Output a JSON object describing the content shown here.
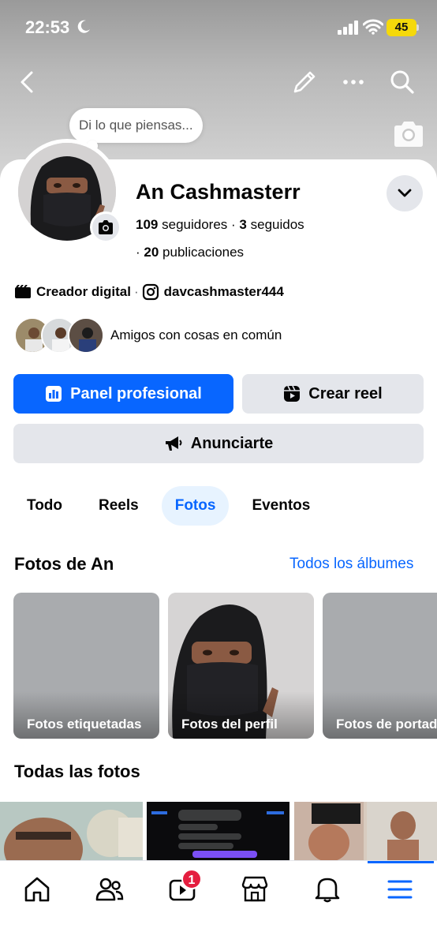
{
  "status_bar": {
    "time": "22:53",
    "battery": "45"
  },
  "profile": {
    "status_prompt": "Di lo que piensas...",
    "name": "An Cashmasterr",
    "followers_count": "109",
    "followers_label": "seguidores",
    "following_count": "3",
    "following_label": "seguidos",
    "posts_count": "20",
    "posts_label": "publicaciones",
    "category": "Creador digital",
    "instagram_handle": "davcashmaster444",
    "mutual_friends_text": "Amigos con cosas en común"
  },
  "actions": {
    "dashboard_label": "Panel profesional",
    "create_reel_label": "Crear reel",
    "advertise_label": "Anunciarte"
  },
  "tabs": [
    {
      "label": "Todo"
    },
    {
      "label": "Reels"
    },
    {
      "label": "Fotos",
      "active": true
    },
    {
      "label": "Eventos"
    }
  ],
  "photos_section": {
    "title": "Fotos de An",
    "see_all_label": "Todos los álbumes",
    "albums": [
      {
        "label": "Fotos etiquetadas"
      },
      {
        "label": "Fotos del perfil"
      },
      {
        "label": "Fotos de portada"
      }
    ]
  },
  "all_photos_title": "Todas las fotos",
  "bottom_nav": {
    "items": [
      "home-icon",
      "friends-icon",
      "video-icon",
      "marketplace-icon",
      "notifications-icon",
      "menu-icon"
    ],
    "video_badge": "1",
    "active": "menu-icon"
  },
  "colors": {
    "brand": "#0866ff",
    "badge": "#e41e3f",
    "button_gray": "#e4e6eb"
  }
}
